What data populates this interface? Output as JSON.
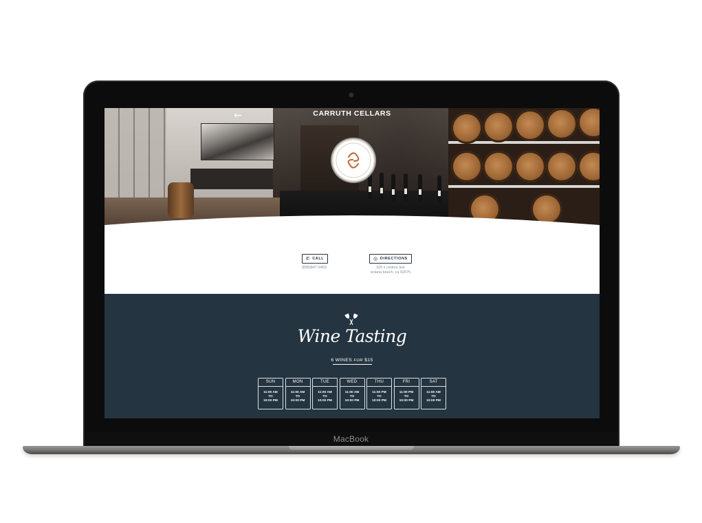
{
  "device": {
    "brand": "MacBook"
  },
  "header": {
    "back_icon": "arrow-left-icon",
    "site_title": "CARRUTH CELLARS"
  },
  "logo": {
    "text": "CARRUTH CELLARS · URBAN WINERY & TASTING ROOM"
  },
  "contact": {
    "call_label": "CALL",
    "call_icon": "phone-icon",
    "phone": "(858)847-9463",
    "directions_label": "DIRECTIONS",
    "directions_icon": "map-pin-icon",
    "address_line1": "320 s cedros ave",
    "address_line2": "solana beach, ca 92075"
  },
  "tasting": {
    "icon": "wine-glasses-icon",
    "title": "Wine Tasting",
    "offer_wines": "6 WINES",
    "offer_for": "FOR",
    "offer_price": "$15",
    "days": [
      {
        "name": "SUN",
        "open": "11:00 AM",
        "to": "TO",
        "close": "10:00 PM"
      },
      {
        "name": "MON",
        "open": "11:00 AM",
        "to": "TO",
        "close": "10:00 PM"
      },
      {
        "name": "TUE",
        "open": "11:00 AM",
        "to": "TO",
        "close": "10:00 PM"
      },
      {
        "name": "WED",
        "open": "11:00 AM",
        "to": "TO",
        "close": "10:00 PM"
      },
      {
        "name": "THU",
        "open": "11:00 PM",
        "to": "TO",
        "close": "10:00 PM"
      },
      {
        "name": "FRI",
        "open": "11:00 PM",
        "to": "TO",
        "close": "10:00 PM"
      },
      {
        "name": "SAT",
        "open": "11:00 AM",
        "to": "TO",
        "close": "10:00 PM"
      }
    ]
  },
  "colors": {
    "navy": "#243440",
    "white": "#ffffff",
    "copper": "#c2703b"
  }
}
